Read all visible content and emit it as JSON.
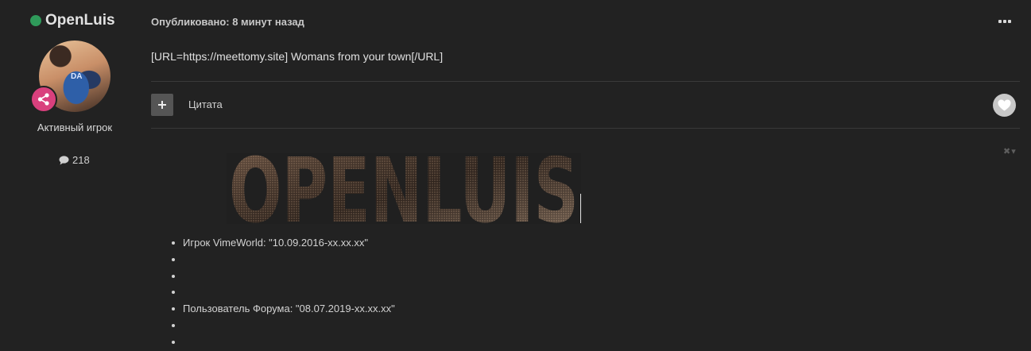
{
  "author": {
    "name": "OpenLuis",
    "avatar_text": "DA",
    "rank": "Активный игрок",
    "post_count": "218"
  },
  "post": {
    "published": "Опубликовано: 8 минут назад",
    "text": "[URL=https://meettomy.site] Womans from your town[/URL]",
    "quote_label": "Цитата"
  },
  "signature": {
    "banner_text": "OPENLUIS",
    "items": [
      "Игрок VimeWorld: \"10.09.2016-xx.xx.xx\"",
      "",
      "",
      "",
      "Пользователь Форума: \"08.07.2019-xx.xx.xx\"",
      "",
      ""
    ]
  },
  "colors": {
    "background": "#222222",
    "online": "#2f9a5a",
    "badge": "#d9407d",
    "divider": "#3a3a3a"
  },
  "icons": [
    "online-indicator-icon",
    "share-icon",
    "comment-icon",
    "more-icon",
    "plus-icon",
    "heart-icon",
    "close-icon",
    "caret-down-icon"
  ]
}
